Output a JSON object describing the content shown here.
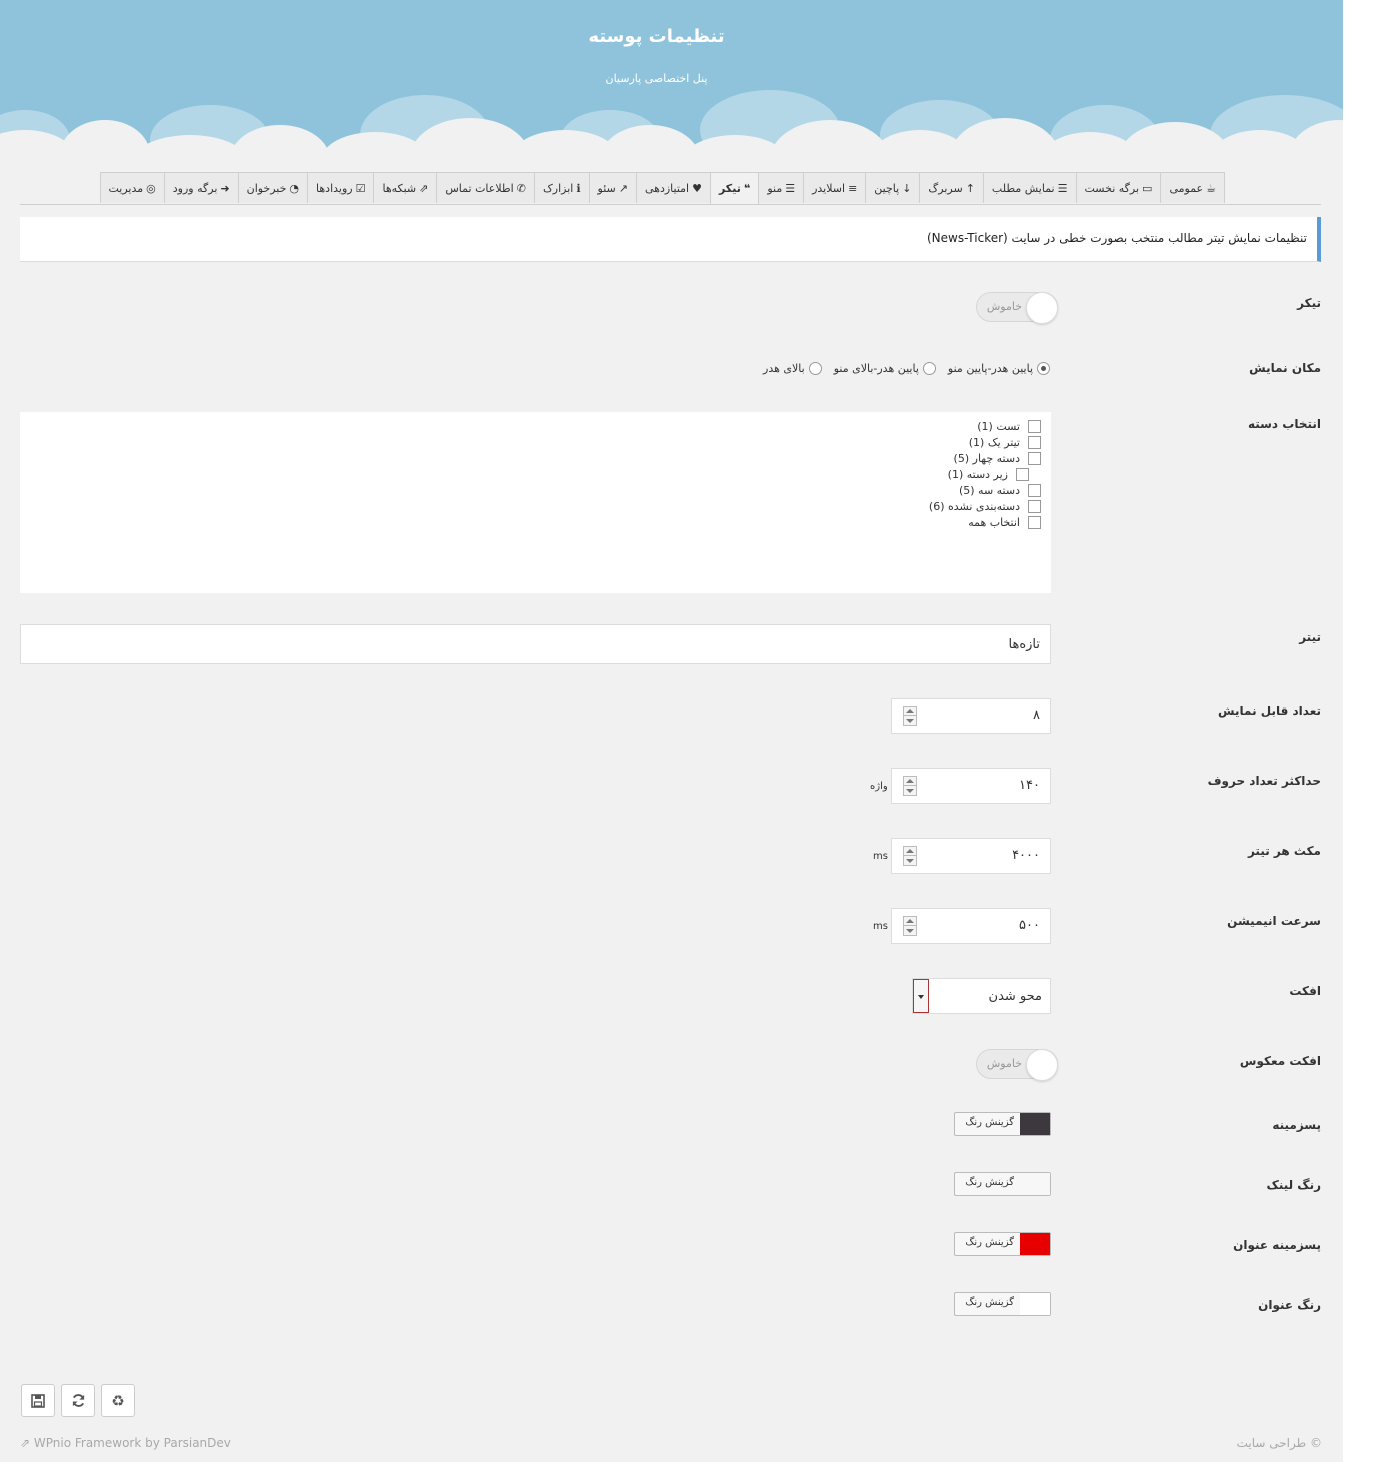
{
  "header": {
    "title": "تنظیمات پوسته",
    "subtitle": "پنل اختصاصی پارسیان"
  },
  "tabs": [
    {
      "label": "عمومی",
      "icon": "coffee-icon",
      "glyph": "☕"
    },
    {
      "label": "برگه نخست",
      "icon": "monitor-icon",
      "glyph": "▭"
    },
    {
      "label": "نمایش مطلب",
      "icon": "list-icon",
      "glyph": "☰"
    },
    {
      "label": "سربرگ",
      "icon": "arrow-up-icon",
      "glyph": "↑"
    },
    {
      "label": "پاچین",
      "icon": "arrow-down-icon",
      "glyph": "↓"
    },
    {
      "label": "اسلایدر",
      "icon": "sliders-icon",
      "glyph": "≡"
    },
    {
      "label": "منو",
      "icon": "menu-icon",
      "glyph": "☰"
    },
    {
      "label": "تیکر",
      "icon": "quote-icon",
      "glyph": "❝"
    },
    {
      "label": "امتیازدهی",
      "icon": "heart-icon",
      "glyph": "♥"
    },
    {
      "label": "سئو",
      "icon": "chart-line-icon",
      "glyph": "↗"
    },
    {
      "label": "ابزارک",
      "icon": "info-icon",
      "glyph": "ℹ"
    },
    {
      "label": "اطلاعات تماس",
      "icon": "phone-icon",
      "glyph": "✆"
    },
    {
      "label": "شبکه‌ها",
      "icon": "share-icon",
      "glyph": "⇗"
    },
    {
      "label": "رویدادها",
      "icon": "calendar-check-icon",
      "glyph": "☑"
    },
    {
      "label": "خبرخوان",
      "icon": "rss-icon",
      "glyph": "◔"
    },
    {
      "label": "برگه ورود",
      "icon": "sign-in-icon",
      "glyph": "➜"
    },
    {
      "label": "مدیریت",
      "icon": "binoculars-icon",
      "glyph": "◎"
    }
  ],
  "active_tab": "تیکر",
  "info_text": "تنظیمات نمایش تیتر مطالب منتخب بصورت خطی در سایت (News-Ticker)",
  "fields": {
    "ticker_label": "تیکر",
    "ticker_state": "خاموش",
    "position_label": "مکان نمایش",
    "position_options": [
      "پایین هدر-پایین منو",
      "پایین هدر-بالای منو",
      "بالای هدر"
    ],
    "position_selected": "پایین هدر-پایین منو",
    "categories_label": "انتخاب دسته",
    "categories": [
      "تست (1)",
      "تیتر یک (1)",
      "دسته چهار (5)",
      "زیر دسته (1)",
      "دسته سه (5)",
      "دسته‌بندی نشده (6)",
      "انتخاب همه"
    ],
    "title_label": "تیتر",
    "title_value": "تازه‌ها",
    "count_label": "تعداد قابل نمایش",
    "count_value": "۸",
    "maxchars_label": "حداکثر تعداد حروف",
    "maxchars_value": "۱۴۰",
    "maxchars_unit": "واژه",
    "pause_label": "مکث هر تیتر",
    "pause_value": "۴۰۰۰",
    "pause_unit": "ms",
    "speed_label": "سرعت انیمیشن",
    "speed_value": "۵۰۰",
    "speed_unit": "ms",
    "effect_label": "افکت",
    "effect_value": "محو شدن",
    "reverse_label": "افکت معکوس",
    "reverse_state": "خاموش",
    "bg_label": "پسزمینه",
    "link_color_label": "رنگ لینک",
    "title_bg_label": "پسزمینه عنوان",
    "title_color_label": "رنگ عنوان",
    "color_button_text": "گزینش رنگ"
  },
  "colors": {
    "bg": "#3d383d",
    "link_color": "#f7f7f7",
    "title_bg": "#e60000",
    "title_color": "#ffffff",
    "accent": "#5b9bd5",
    "header_sky": "#8fc3db"
  },
  "footer": {
    "save_icon": "save-icon",
    "reset_icon": "refresh-icon",
    "restore_icon": "recycle-icon",
    "credit_left": "WPnio Framework by ParsianDev",
    "credit_right": "© طراحی سایت"
  }
}
